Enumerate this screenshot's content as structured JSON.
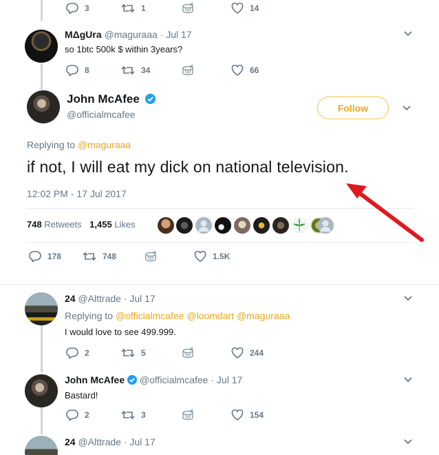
{
  "top_tweet": {
    "replies": "3",
    "retweets": "1",
    "likes": "14"
  },
  "reply1": {
    "name": "MΔgUra",
    "handle": "@maguraaa",
    "date": "· Jul 17",
    "text": "so 1btc 500k $ within 3years?",
    "replies": "8",
    "retweets": "34",
    "likes": "66"
  },
  "main": {
    "name": "John McAfee",
    "handle": "@officialmcafee",
    "follow_label": "Follow",
    "replying_prefix": "Replying to ",
    "replying_to": "@maguraaa",
    "text": "if not, I will eat my dick on national television.",
    "timestamp": "12:02 PM - 17 Jul 2017",
    "retweet_count": "748",
    "retweet_label": "Retweets",
    "like_count": "1,455",
    "like_label": "Likes",
    "replies": "178",
    "retweets": "748",
    "likes": "1.5K"
  },
  "reply2": {
    "name": "24",
    "handle": "@Alttrade",
    "date": "· Jul 17",
    "replying_prefix": "Replying to ",
    "replying_to": "@officialmcafee @loomdart @maguraaa",
    "text": "I would love to see 499.999.",
    "replies": "2",
    "retweets": "5",
    "likes": "244"
  },
  "reply3": {
    "name": "John McAfee",
    "handle": "@officialmcafee",
    "date": "· Jul 17",
    "text": "Bastard!",
    "replies": "2",
    "retweets": "3",
    "likes": "154"
  },
  "reply4": {
    "name": "24",
    "handle": "@Alttrade",
    "date": "· Jul 17"
  },
  "colors": {
    "accent": "#f0a71b",
    "annotation_arrow": "#e0191f"
  }
}
